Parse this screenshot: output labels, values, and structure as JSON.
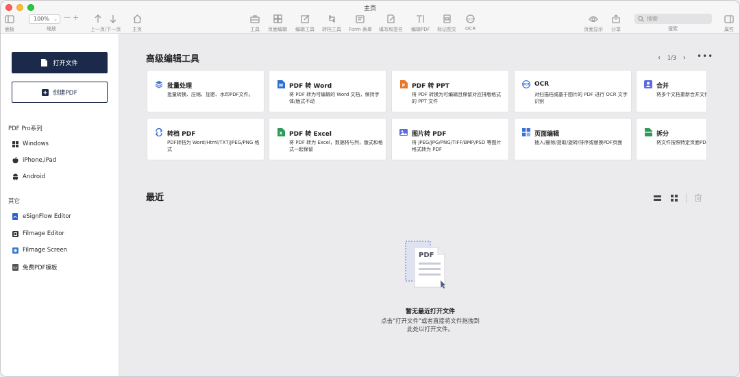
{
  "window": {
    "title": "主页"
  },
  "toolbar": {
    "zoom_value": "100%",
    "search_placeholder": "搜索",
    "items": {
      "panel": "面板",
      "zoom": "缩放",
      "prev_next": "上一页/下一页",
      "home": "主页",
      "tools": "工具",
      "page_edit": "页面编辑",
      "edit_tools": "编辑工具",
      "convert_tools": "转档工具",
      "form": "Form 表单",
      "fill_sign": "填写和签名",
      "edit_pdf": "编辑PDF",
      "annotate": "标记图文",
      "ocr": "OCR",
      "page_display": "页面显示",
      "share": "分享",
      "search": "搜索",
      "properties": "属性"
    }
  },
  "sidebar": {
    "open_file": "打开文件",
    "create_pdf": "创建PDF",
    "pro_section": "PDF Pro系列",
    "pro_items": [
      {
        "label": "Windows",
        "icon": "windows-icon"
      },
      {
        "label": "iPhone,iPad",
        "icon": "apple-icon"
      },
      {
        "label": "Android",
        "icon": "android-icon"
      }
    ],
    "other_section": "其它",
    "other_items": [
      {
        "label": "eSignFlow Editor",
        "icon": "esignflow-icon"
      },
      {
        "label": "Filmage Editor",
        "icon": "filmage-editor-icon"
      },
      {
        "label": "Filmage Screen",
        "icon": "filmage-screen-icon"
      },
      {
        "label": "免费PDF模板",
        "icon": "pdf-template-icon"
      }
    ]
  },
  "tools_section": {
    "title": "高级编辑工具",
    "page_indicator": "1/3",
    "cards": [
      {
        "title": "批量处理",
        "desc": "批量转换、压缩、加密、水印PDF文件。",
        "icon": "layers-icon",
        "color": "#3a6fd8"
      },
      {
        "title": "PDF 转 Word",
        "desc": "将 PDF 转为可编辑的 Word 文档，保持字体/版式不动",
        "icon": "word-icon",
        "color": "#2b6fd6"
      },
      {
        "title": "PDF 转 PPT",
        "desc": "将 PDF 转换为可编辑且保留对应排版格式的 PPT 文件",
        "icon": "ppt-icon",
        "color": "#e8782a"
      },
      {
        "title": "OCR",
        "desc": "对扫描档或基于图片的 PDF 进行 OCR 文字识别",
        "icon": "ocr-icon",
        "color": "#3a6fd8"
      },
      {
        "title": "合并",
        "desc": "将多个文档重新合并文件",
        "icon": "merge-icon",
        "color": "#5b6be0"
      },
      {
        "title": "转档 PDF",
        "desc": "PDF转档为 Word/Html/TXT/JPEG/PNG 格式",
        "icon": "convert-icon",
        "color": "#3a6fd8"
      },
      {
        "title": "PDF 转 Excel",
        "desc": "将 PDF 转为 Excel，数据将与列，版式和格式一起保留",
        "icon": "excel-icon",
        "color": "#2e9a5a"
      },
      {
        "title": "图片转 PDF",
        "desc": "将 JPEG/JPG/PNG/TIFF/BMP/PSD 等图片格式转为 PDF",
        "icon": "image-icon",
        "color": "#5b6be0"
      },
      {
        "title": "页面编辑",
        "desc": "插入/删除/提取/旋转/排序或替换PDF页面",
        "icon": "grid-icon",
        "color": "#3a6fd8"
      },
      {
        "title": "拆分",
        "desc": "将文件按照特定页面PDF文件",
        "icon": "split-icon",
        "color": "#2e9a5a"
      }
    ]
  },
  "recent_section": {
    "title": "最近",
    "empty_title": "暂无最近打开文件",
    "empty_desc_line1": "点击\"打开文件\"或者直接将文件拖拽到",
    "empty_desc_line2": "此处以打开文件。",
    "illustration_label": "PDF"
  },
  "colors": {
    "primary": "#1b2a4a",
    "background": "#ebebed",
    "sidebar": "#ffffff"
  }
}
